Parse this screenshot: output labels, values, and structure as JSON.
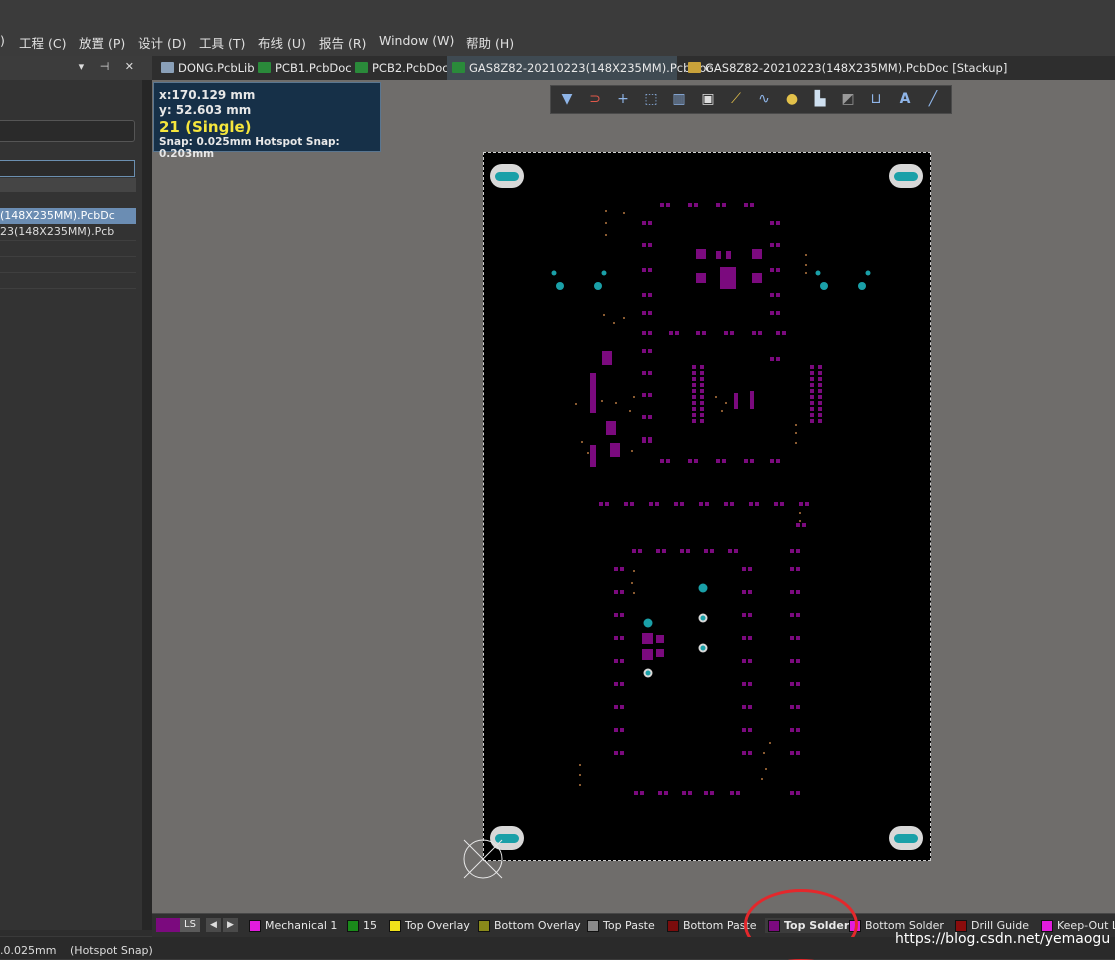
{
  "menubar": {
    "items": [
      {
        "label": ")"
      },
      {
        "label": "工程 (C)"
      },
      {
        "label": "放置 (P)"
      },
      {
        "label": "设计 (D)"
      },
      {
        "label": "工具 (T)"
      },
      {
        "label": "布线 (U)"
      },
      {
        "label": "报告 (R)"
      },
      {
        "label": "Window (W)"
      },
      {
        "label": "帮助 (H)"
      }
    ]
  },
  "left_panel": {
    "header_icons": "▾ ⊣ ✕",
    "rows": [
      {
        "label": "(148X235MM).PcbDc"
      },
      {
        "label": "23(148X235MM).Pcb"
      }
    ]
  },
  "tabs": [
    {
      "label": "DONG.PcbLib",
      "icon": "pcblib-icon"
    },
    {
      "label": "PCB1.PcbDoc",
      "icon": "pcb-icon"
    },
    {
      "label": "PCB2.PcbDoc",
      "icon": "pcb-icon"
    },
    {
      "label": "GAS8Z82-20210223(148X235MM).PcbDoc",
      "icon": "pcb-icon",
      "active": true
    },
    {
      "label": "GAS8Z82-20210223(148X235MM).PcbDoc [Stackup]",
      "icon": "stackup-icon"
    }
  ],
  "coords": {
    "x": "x:170.129 mm",
    "y": "y: 52.603  mm",
    "layer": "21 (Single)",
    "snap": "Snap: 0.025mm Hotspot Snap: 0.203mm"
  },
  "toolbar": [
    "filter-icon",
    "magnet-icon",
    "plus-icon",
    "select-rect-icon",
    "bar-chart-icon",
    "component-icon",
    "route-icon",
    "diff-pair-icon",
    "bulb-icon",
    "polygon-icon",
    "rect-icon",
    "dimension-icon",
    "text-icon",
    "line-icon"
  ],
  "layers": [
    {
      "name": "Mechanical 1",
      "color": "#e21cdd"
    },
    {
      "name": "15",
      "color": "#1a8a1a"
    },
    {
      "name": "Top Overlay",
      "color": "#f0e21a"
    },
    {
      "name": "Bottom Overlay",
      "color": "#8a8a1a"
    },
    {
      "name": "Top Paste",
      "color": "#8a8a8a"
    },
    {
      "name": "Bottom Paste",
      "color": "#7a0c0c"
    },
    {
      "name": "Top Solder",
      "color": "#7b0a7e",
      "active": true
    },
    {
      "name": "Bottom Solder",
      "color": "#e21cdd"
    },
    {
      "name": "Drill Guide",
      "color": "#8a0c0c"
    },
    {
      "name": "Keep-Out L",
      "color": "#e21cdd"
    }
  ],
  "layerbar": {
    "ls": "LS"
  },
  "status": {
    "grid": ".0.025mm",
    "snap": "(Hotspot Snap)"
  },
  "watermark": "https://blog.csdn.net/yemaogu",
  "colors": {
    "pad": "#7b0a7e",
    "hole": "#1aa0a8",
    "board": "#000000",
    "canvas": "#6f6d6b"
  }
}
